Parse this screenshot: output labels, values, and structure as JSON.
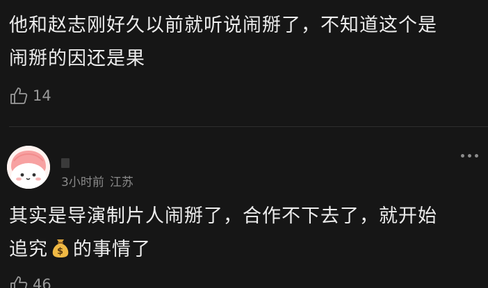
{
  "comments": [
    {
      "text_line1": "他和赵志刚好久以前就听说闹掰了，不知道这个是",
      "text_line2": "闹掰的因还是果",
      "likes": "14"
    },
    {
      "username": "",
      "time": "3小时前",
      "location": "江苏",
      "text_line1": "其实是导演制片人闹掰了，合作不下去了，就开始",
      "text_line2_before": "追究",
      "emoji": "money-bag-emoji",
      "text_line2_after": "的事情了",
      "likes": "46"
    }
  ],
  "colors": {
    "background": "#161616",
    "text": "#ececec",
    "meta": "#8a8a8a"
  }
}
